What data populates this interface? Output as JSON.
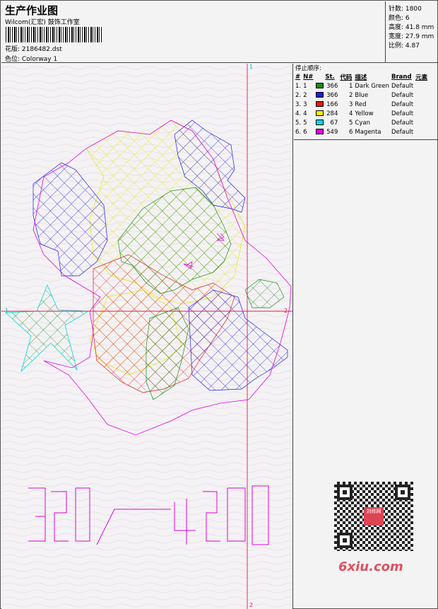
{
  "header": {
    "title": "生产作业图",
    "company": "Wilcom(汇宏) 鼓饰工作室",
    "pattern_label": "花版:",
    "pattern_value": "2186482.dst",
    "colorway_label": "色位:",
    "colorway_value": "Colorway 1"
  },
  "specs": {
    "stitches": "针数: 1800",
    "colors": "颜色: 6",
    "height": "高度: 41.8 mm",
    "width": "宽度: 27.9 mm",
    "scale": "比例: 4.87"
  },
  "stop_sequence": {
    "caption": "停止顺序:",
    "headers": [
      "#",
      "N#",
      "St.",
      "代码",
      "描述",
      "Brand",
      "元素"
    ],
    "rows": [
      {
        "no": "1.",
        "n": "1",
        "color": "#1a8c1a",
        "st": "366",
        "code": "1",
        "desc": "Dark Green",
        "brand": "Default"
      },
      {
        "no": "2.",
        "n": "2",
        "color": "#1a1ae0",
        "st": "366",
        "code": "2",
        "desc": "Blue",
        "brand": "Default"
      },
      {
        "no": "3.",
        "n": "3",
        "color": "#e01a1a",
        "st": "166",
        "code": "3",
        "desc": "Red",
        "brand": "Default"
      },
      {
        "no": "4.",
        "n": "4",
        "color": "#f0f000",
        "st": "284",
        "code": "4",
        "desc": "Yellow",
        "brand": "Default"
      },
      {
        "no": "5.",
        "n": "5",
        "color": "#00e0e0",
        "st": "67",
        "code": "5",
        "desc": "Cyan",
        "brand": "Default"
      },
      {
        "no": "6.",
        "n": "6",
        "color": "#e000e0",
        "st": "549",
        "code": "6",
        "desc": "Magenta",
        "brand": "Default"
      }
    ]
  },
  "canvas": {
    "axis_marks": [
      "1",
      "2",
      "1",
      "2"
    ],
    "design_text": "321-420"
  },
  "watermark": "6xiu.com",
  "qr_logo_text": "刘修网"
}
